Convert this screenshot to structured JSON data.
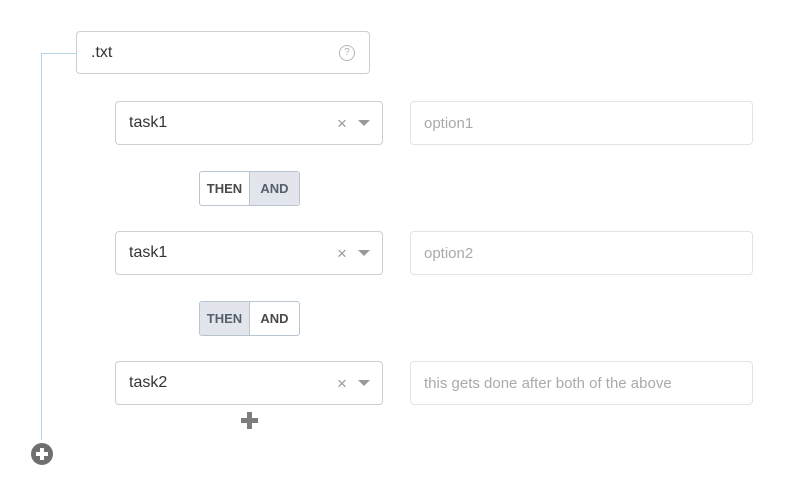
{
  "root": {
    "value": ".txt",
    "help_glyph": "?"
  },
  "rows": [
    {
      "task": "task1",
      "clear_glyph": "×",
      "option_value": "",
      "option_placeholder": "option1"
    },
    {
      "task": "task1",
      "clear_glyph": "×",
      "option_value": "",
      "option_placeholder": "option2"
    },
    {
      "task": "task2",
      "clear_glyph": "×",
      "option_value": "",
      "option_placeholder": "this gets done after both of the above"
    }
  ],
  "connectors": [
    {
      "then_label": "THEN",
      "and_label": "AND",
      "active": "AND"
    },
    {
      "then_label": "THEN",
      "and_label": "AND",
      "active": "THEN"
    }
  ],
  "icons": {
    "help": "question-circle-icon",
    "clear": "close-icon",
    "caret": "caret-down-icon",
    "add_condition": "plus-icon",
    "add_root": "plus-circle-icon"
  },
  "colors": {
    "tree_line": "#b9d3e6",
    "toggle_active_bg": "#e2e5eb",
    "toggle_border": "#b8c4cf"
  }
}
